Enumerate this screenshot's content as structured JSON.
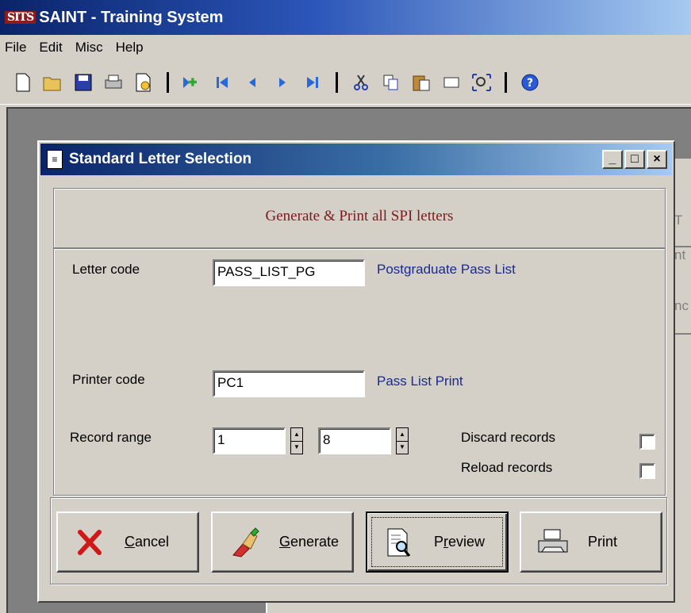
{
  "app": {
    "logo_text": "SITS",
    "title": "SAINT - Training System"
  },
  "menu": [
    "File",
    "Edit",
    "Misc",
    "Help"
  ],
  "toolbar_icons": [
    "new-icon",
    "open-folder-icon",
    "save-icon",
    "print-icon",
    "print-preview-icon",
    "add-record-icon",
    "first-record-icon",
    "previous-record-icon",
    "next-record-icon",
    "last-record-icon",
    "cut-icon",
    "copy-icon",
    "paste-icon",
    "clear-icon",
    "zoom-icon",
    "help-icon"
  ],
  "dialog": {
    "title": "Standard Letter Selection",
    "win_buttons": {
      "minimize": "_",
      "maximize": "□",
      "close": "×"
    },
    "subtitle": "Generate & Print all SPI letters",
    "letter_code": {
      "label": "Letter code",
      "value": "PASS_LIST_PG",
      "description": "Postgraduate Pass List"
    },
    "printer_code": {
      "label": "Printer code",
      "value": "PC1",
      "description": "Pass List Print"
    },
    "record_range": {
      "label": "Record range",
      "from": "1",
      "to": "8"
    },
    "discard_records": {
      "label": "Discard records",
      "checked": false
    },
    "reload_records": {
      "label": "Reload records",
      "checked": false
    },
    "buttons": {
      "cancel": {
        "first": "C",
        "rest": "ancel"
      },
      "generate": {
        "first": "G",
        "rest": "enerate"
      },
      "preview": {
        "before": "P",
        "underlined": "r",
        "after": "eview"
      },
      "print": "Print"
    }
  },
  "background_peek": [
    "T",
    "nt",
    "nc"
  ],
  "colors": {
    "title_bar": "#0a246a",
    "subtitle_text": "#7a1c1c",
    "description_text": "#1a2a8c",
    "window_face": "#d4d0c8"
  }
}
